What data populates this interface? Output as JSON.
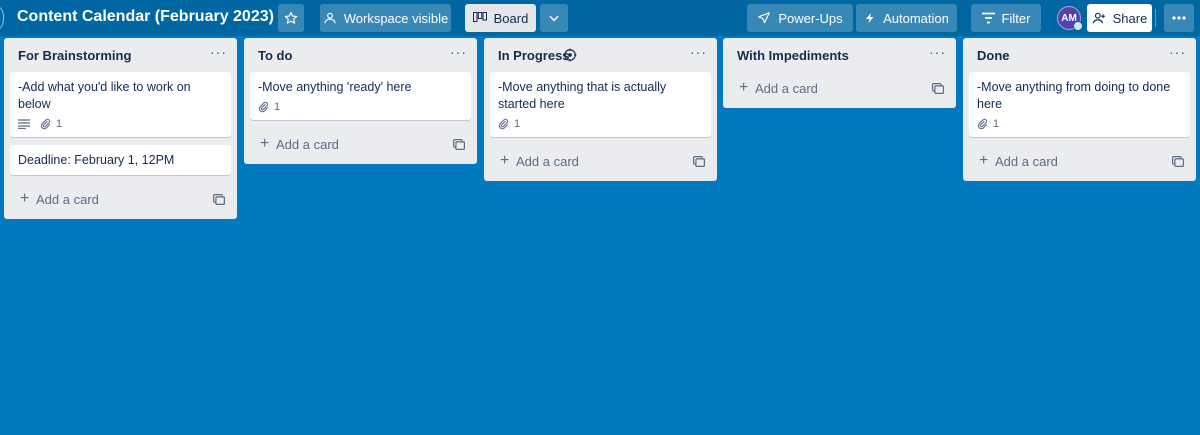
{
  "header": {
    "board_title": "Content Calendar (February 2023)",
    "workspace_visible": "Workspace visible",
    "board_view": "Board",
    "power_ups": "Power-Ups",
    "automation": "Automation",
    "filter": "Filter",
    "avatar_initials": "AM",
    "share": "Share"
  },
  "lists": [
    {
      "title": "For Brainstorming",
      "cards": [
        {
          "text": "-Add what you'd like to work on below",
          "attachments": "1"
        },
        {
          "text": "Deadline: February 1, 12PM"
        }
      ],
      "add_card": "Add a card"
    },
    {
      "title": "To do",
      "cards": [
        {
          "text": "-Move anything 'ready' here",
          "attachments": "1"
        }
      ],
      "add_card": "Add a card"
    },
    {
      "title": "In Progress",
      "cards": [
        {
          "text": "-Move anything that is actually started here",
          "attachments": "1"
        }
      ],
      "add_card": "Add a card"
    },
    {
      "title": "With Impediments",
      "cards": [],
      "add_card": "Add a card"
    },
    {
      "title": "Done",
      "cards": [
        {
          "text": "-Move anything from doing to done here",
          "attachments": "1"
        }
      ],
      "add_card": "Add a card"
    }
  ],
  "colors": {
    "board_bg": "#0079bf",
    "header_bg": "#0067a3",
    "list_bg": "#ebecf0",
    "avatar_bg": "#5243aa"
  }
}
